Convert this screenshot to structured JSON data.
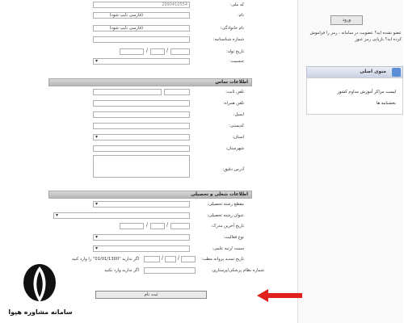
{
  "sidebar": {
    "login_label": "ورود",
    "note": "عضو نشده اید؟ عضویت در سامانه ، رمز را فراموش کرده اید؟ بازیابی رمز عبور",
    "menu_title": "منوی اصلی",
    "links": [
      "لیست مراکز آموزش مداوم کشور",
      "بخشنامه ها"
    ]
  },
  "form": {
    "code_label": "کد ملی:",
    "code_value": "2990410554",
    "name_label": "نام:",
    "name_hint": "(فارسی تایپ شود)",
    "family_label": "نام خانوادگی:",
    "family_hint": "(فارسی تایپ شود)",
    "idno_label": "شماره شناسنامه:",
    "birth_label": "تاریخ تولد:",
    "gender_label": "جنسیت:",
    "contact_section": "اطلاعات تماس",
    "phone_label": "تلفن ثابت:",
    "mobile_label": "تلفن همراه:",
    "email_label": "ایمیل:",
    "postal_label": "کدپستی:",
    "province_label": "استان:",
    "city_label": "شهرستان:",
    "address_label": "آدرس دقیق:",
    "job_section": "اطلاعات شغلی و تحصیلی",
    "degree_label": "مقطع رشته تحصیلی:",
    "field_label": "عنوان رشته تحصیلی:",
    "issue_label": "تاریخ آخرین مدرک:",
    "activity_label": "نوع فعالیت:",
    "rank_label": "سمت /رتبه علمی:",
    "renew_label": "تاریخ تمدید پروانه مطب:",
    "renew_hint": "اگر ندارید \"01/01/1300\" را وارد کنید",
    "medical_label": "شماره نظام پزشکی/پرستاری:",
    "medical_hint": "اگر ندارید وارد نکنید",
    "submit_label": "ثبت نام"
  },
  "brand": {
    "name": "سامانه مشاوره هپوا"
  },
  "colors": {
    "arrow": "#e0201b",
    "section": "#c4c4c4",
    "menu": "#d3d9e8"
  }
}
